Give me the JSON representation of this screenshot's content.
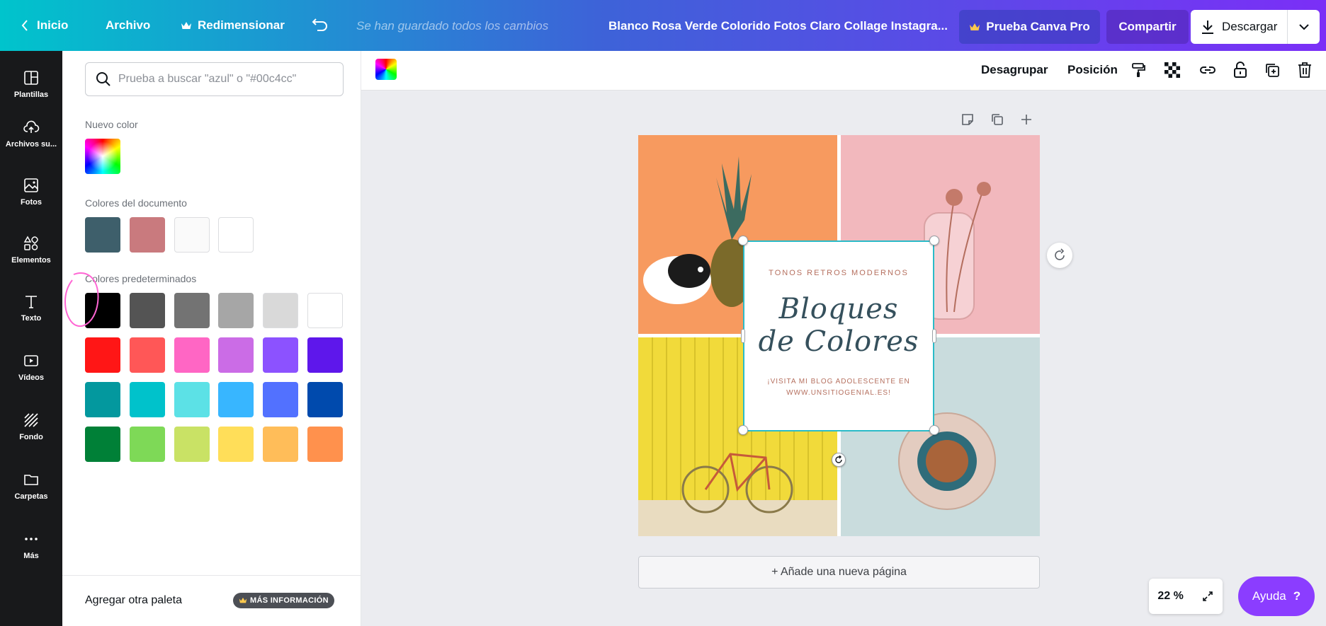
{
  "topbar": {
    "home": "Inicio",
    "file": "Archivo",
    "resize": "Redimensionar",
    "saved_status": "Se han guardado todos los cambios",
    "document_title": "Blanco Rosa Verde Colorido Fotos Claro Collage Instagra...",
    "pro_button": "Prueba Canva Pro",
    "share_button": "Compartir",
    "download_button": "Descargar"
  },
  "sidebar": {
    "items": [
      {
        "label": "Plantillas",
        "icon": "template-icon"
      },
      {
        "label": "Archivos su...",
        "icon": "upload-cloud-icon"
      },
      {
        "label": "Fotos",
        "icon": "photo-icon"
      },
      {
        "label": "Elementos",
        "icon": "elements-icon"
      },
      {
        "label": "Texto",
        "icon": "text-icon"
      },
      {
        "label": "Vídeos",
        "icon": "video-icon"
      },
      {
        "label": "Fondo",
        "icon": "background-icon"
      },
      {
        "label": "Carpetas",
        "icon": "folder-icon"
      },
      {
        "label": "Más",
        "icon": "more-icon"
      }
    ]
  },
  "color_panel": {
    "search_placeholder": "Prueba a buscar \"azul\" o \"#00c4cc\"",
    "new_color_label": "Nuevo color",
    "document_colors_label": "Colores del documento",
    "document_colors": [
      "#3e5f6b",
      "#c97a7e",
      "#fafafa",
      "#ffffff"
    ],
    "default_colors_label": "Colores predeterminados",
    "default_colors": [
      [
        "#000000",
        "#545454",
        "#737373",
        "#a6a6a6",
        "#d9d9d9",
        "#ffffff"
      ],
      [
        "#ff1616",
        "#ff5757",
        "#ff66c4",
        "#cb6ce6",
        "#8c52ff",
        "#5e17eb"
      ],
      [
        "#03989e",
        "#00c2cb",
        "#5ce1e6",
        "#38b6ff",
        "#5271ff",
        "#004aad"
      ],
      [
        "#008037",
        "#7ed957",
        "#c9e265",
        "#ffde59",
        "#ffbd59",
        "#ff914d"
      ]
    ],
    "footer_text": "Agregar otra paleta",
    "footer_badge": "MÁS INFORMACIÓN",
    "annotation_color": "#ff66d4"
  },
  "context_toolbar": {
    "ungroup": "Desagrupar",
    "position": "Posición"
  },
  "design": {
    "subtitle": "TONOS RETROS MODERNOS",
    "title_line1": "Bloques",
    "title_line2": "de Colores",
    "footer_line1": "¡VISITA MI BLOG ADOLESCENTE EN",
    "footer_line2": "WWW.UNSITIOGENIAL.ES!",
    "quadrant_colors": [
      "#f79a5f",
      "#f2b8bd",
      "#f1da3a",
      "#c9dcdd"
    ]
  },
  "canvas": {
    "add_page": "+ Añade una nueva página",
    "zoom": "22 %",
    "help": "Ayuda",
    "help_mark": "?"
  },
  "colors": {
    "brand_gradient_start": "#00c4cc",
    "brand_gradient_end": "#7b2ff7",
    "accent": "#8b3dff",
    "selection": "#2bbbc8"
  }
}
